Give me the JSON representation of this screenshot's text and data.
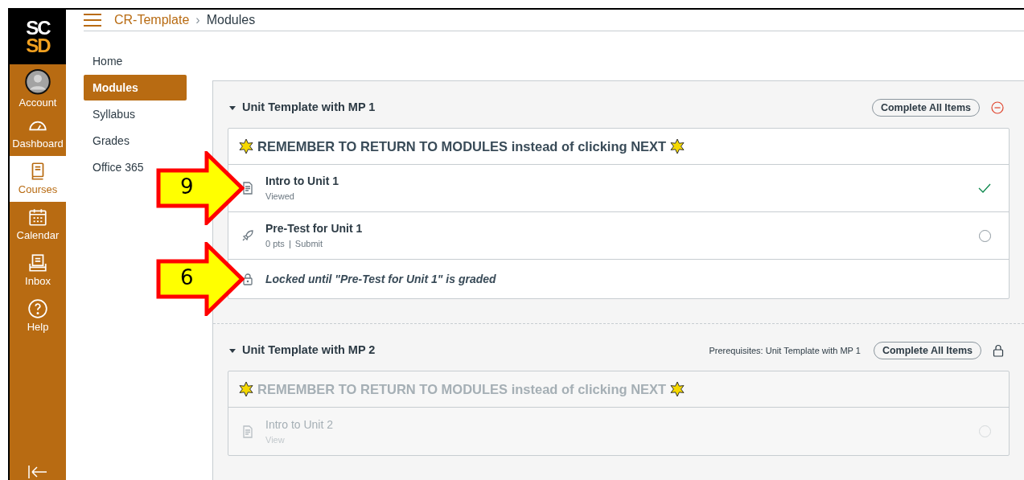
{
  "logo": {
    "lines": [
      "SC",
      "SD"
    ]
  },
  "global_nav": [
    {
      "kind": "account",
      "label": "Account",
      "selected": false
    },
    {
      "kind": "dashboard",
      "label": "Dashboard",
      "selected": false
    },
    {
      "kind": "courses",
      "label": "Courses",
      "selected": true
    },
    {
      "kind": "calendar",
      "label": "Calendar",
      "selected": false
    },
    {
      "kind": "inbox",
      "label": "Inbox",
      "selected": false
    },
    {
      "kind": "help",
      "label": "Help",
      "selected": false
    }
  ],
  "breadcrumb": {
    "course": "CR-Template",
    "separator": "›",
    "page": "Modules"
  },
  "course_nav": [
    {
      "label": "Home",
      "selected": false
    },
    {
      "label": "Modules",
      "selected": true
    },
    {
      "label": "Syllabus",
      "selected": false
    },
    {
      "label": "Grades",
      "selected": false
    },
    {
      "label": "Office 365",
      "selected": false
    }
  ],
  "modules": [
    {
      "title": "Unit Template with MP 1",
      "locked": false,
      "dimmed": false,
      "button": "Complete All Items",
      "items": [
        {
          "kind": "header",
          "title": "REMEMBER TO RETURN TO MODULES instead of clicking NEXT"
        },
        {
          "kind": "page",
          "title": "Intro to Unit 1",
          "meta": [
            "Viewed"
          ],
          "completed": true,
          "annotation": "9"
        },
        {
          "kind": "quiz",
          "title": "Pre-Test for Unit 1",
          "meta": [
            "0 pts",
            "Submit"
          ],
          "completed": false
        },
        {
          "kind": "lock",
          "title": "Locked until \"Pre-Test for Unit 1\" is graded",
          "annotation": "6"
        }
      ]
    },
    {
      "title": "Unit Template with MP 2",
      "locked": true,
      "dimmed": true,
      "prerequisites": "Prerequisites: Unit Template with MP 1",
      "button": "Complete All Items",
      "items": [
        {
          "kind": "header",
          "title": "REMEMBER TO RETURN TO MODULES instead of clicking NEXT"
        },
        {
          "kind": "page",
          "title": "Intro to Unit 2",
          "meta": [
            "View"
          ],
          "completed": false
        }
      ]
    }
  ]
}
